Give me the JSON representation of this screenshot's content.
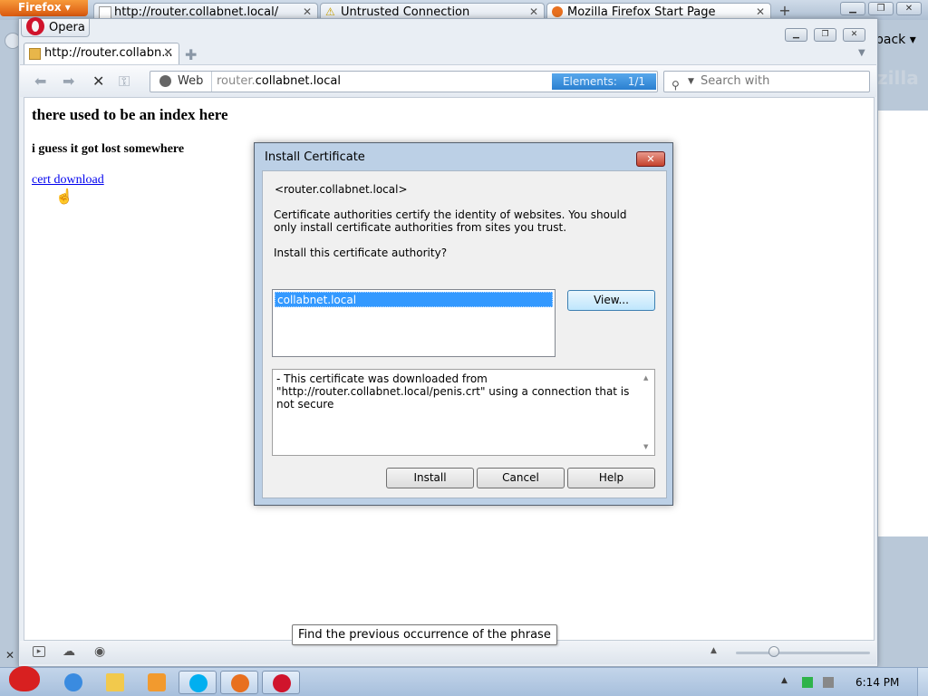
{
  "firefox": {
    "button_label": "Firefox",
    "tabs": [
      {
        "title": "http://router.collabnet.local/"
      },
      {
        "title": "Untrusted Connection"
      },
      {
        "title": "Mozilla Firefox Start Page"
      }
    ],
    "back_text": "back",
    "brand_fragment": "zilla"
  },
  "opera": {
    "menu_label": "Opera",
    "tab": {
      "title": "http://router.collabn..."
    },
    "address": {
      "scope": "Web",
      "host_dim": "router.",
      "host_rest": "collabnet.local",
      "elements_label": "Elements:",
      "elements_count": "1/1"
    },
    "search_placeholder": "Search with",
    "page": {
      "heading": "there used to be an index here",
      "subheading": "i guess it got lost somewhere",
      "link": "cert download"
    },
    "tooltip": "Find the previous occurrence of the phrase"
  },
  "dialog": {
    "title": "Install Certificate",
    "host": "<router.collabnet.local>",
    "description": "Certificate authorities certify the identity of websites. You should only install certificate authorities from sites you trust.",
    "question": "Install this certificate authority?",
    "certificates": [
      "collabnet.local"
    ],
    "view_button": "View...",
    "details": "- This certificate was downloaded from \"http://router.collabnet.local/penis.crt\" using a connection that is not secure",
    "install_button": "Install",
    "cancel_button": "Cancel",
    "help_button": "Help"
  },
  "taskbar": {
    "time": "6:14 PM"
  },
  "colors": {
    "selection": "#3399ff",
    "elements_badge": "#2a7fd0",
    "link": "#0000ee",
    "firefox_orange": "#e8701f",
    "opera_red": "#d0142c"
  }
}
